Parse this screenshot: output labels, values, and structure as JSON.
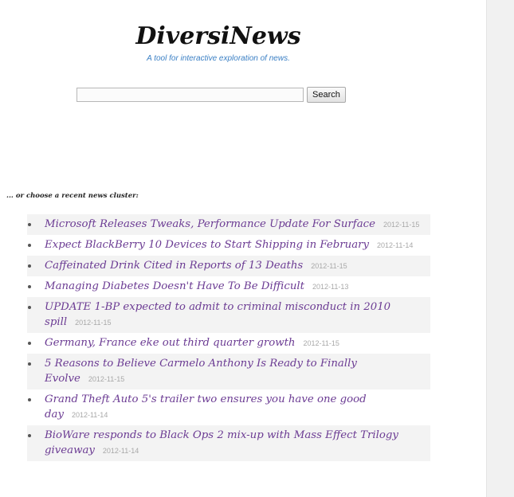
{
  "header": {
    "title": "DiversiNews",
    "tagline": "A tool for interactive exploration of news."
  },
  "search": {
    "value": "",
    "button_label": "Search"
  },
  "clusters": {
    "heading": "... or choose a recent news cluster:",
    "items": [
      {
        "title": "Microsoft Releases Tweaks, Performance Update For Surface",
        "date": "2012-11-15"
      },
      {
        "title": "Expect BlackBerry 10 Devices to Start Shipping in February",
        "date": "2012-11-14"
      },
      {
        "title": "Caffeinated Drink Cited in Reports of 13 Deaths",
        "date": "2012-11-15"
      },
      {
        "title": "Managing Diabetes Doesn't Have To Be Difficult",
        "date": "2012-11-13"
      },
      {
        "title": "UPDATE 1-BP expected to admit to criminal misconduct in 2010 spill",
        "date": "2012-11-15"
      },
      {
        "title": "Germany, France eke out third quarter growth",
        "date": "2012-11-15"
      },
      {
        "title": "5 Reasons to Believe Carmelo Anthony Is Ready to Finally Evolve",
        "date": "2012-11-15"
      },
      {
        "title": "Grand Theft Auto 5's trailer two ensures you have one good day",
        "date": "2012-11-14"
      },
      {
        "title": "BioWare responds to Black Ops 2 mix-up with Mass Effect Trilogy giveaway",
        "date": "2012-11-14"
      }
    ]
  }
}
